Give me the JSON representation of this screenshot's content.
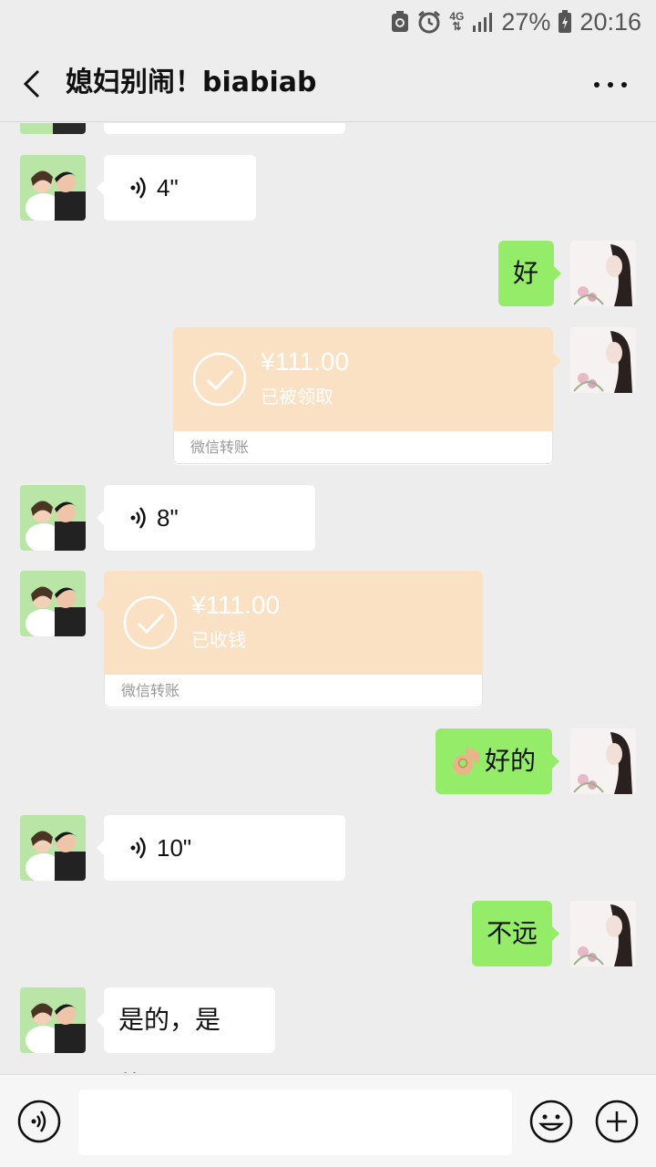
{
  "status_bar": {
    "network": "4G",
    "battery": "27%",
    "time": "20:16"
  },
  "header": {
    "title": "媳妇别闹！biabiab"
  },
  "messages": [
    {
      "side": "left",
      "type": "voice",
      "duration": "4\""
    },
    {
      "side": "right",
      "type": "text",
      "text": "好"
    },
    {
      "side": "right",
      "type": "transfer",
      "amount": "¥111.00",
      "status": "已被领取",
      "footer": "微信转账"
    },
    {
      "side": "left",
      "type": "voice",
      "duration": "8\""
    },
    {
      "side": "left",
      "type": "transfer",
      "amount": "¥111.00",
      "status": "已收钱",
      "footer": "微信转账"
    },
    {
      "side": "right",
      "type": "text",
      "emoji": "👌",
      "text": "好的"
    },
    {
      "side": "left",
      "type": "voice",
      "duration": "10\""
    },
    {
      "side": "right",
      "type": "text",
      "text": "不远"
    },
    {
      "side": "left",
      "type": "text",
      "text": "是的，是的。"
    }
  ],
  "colors": {
    "background": "#ededed",
    "sent_bubble": "#95ec69",
    "received_bubble": "#ffffff",
    "transfer": "#fbe1c3"
  }
}
